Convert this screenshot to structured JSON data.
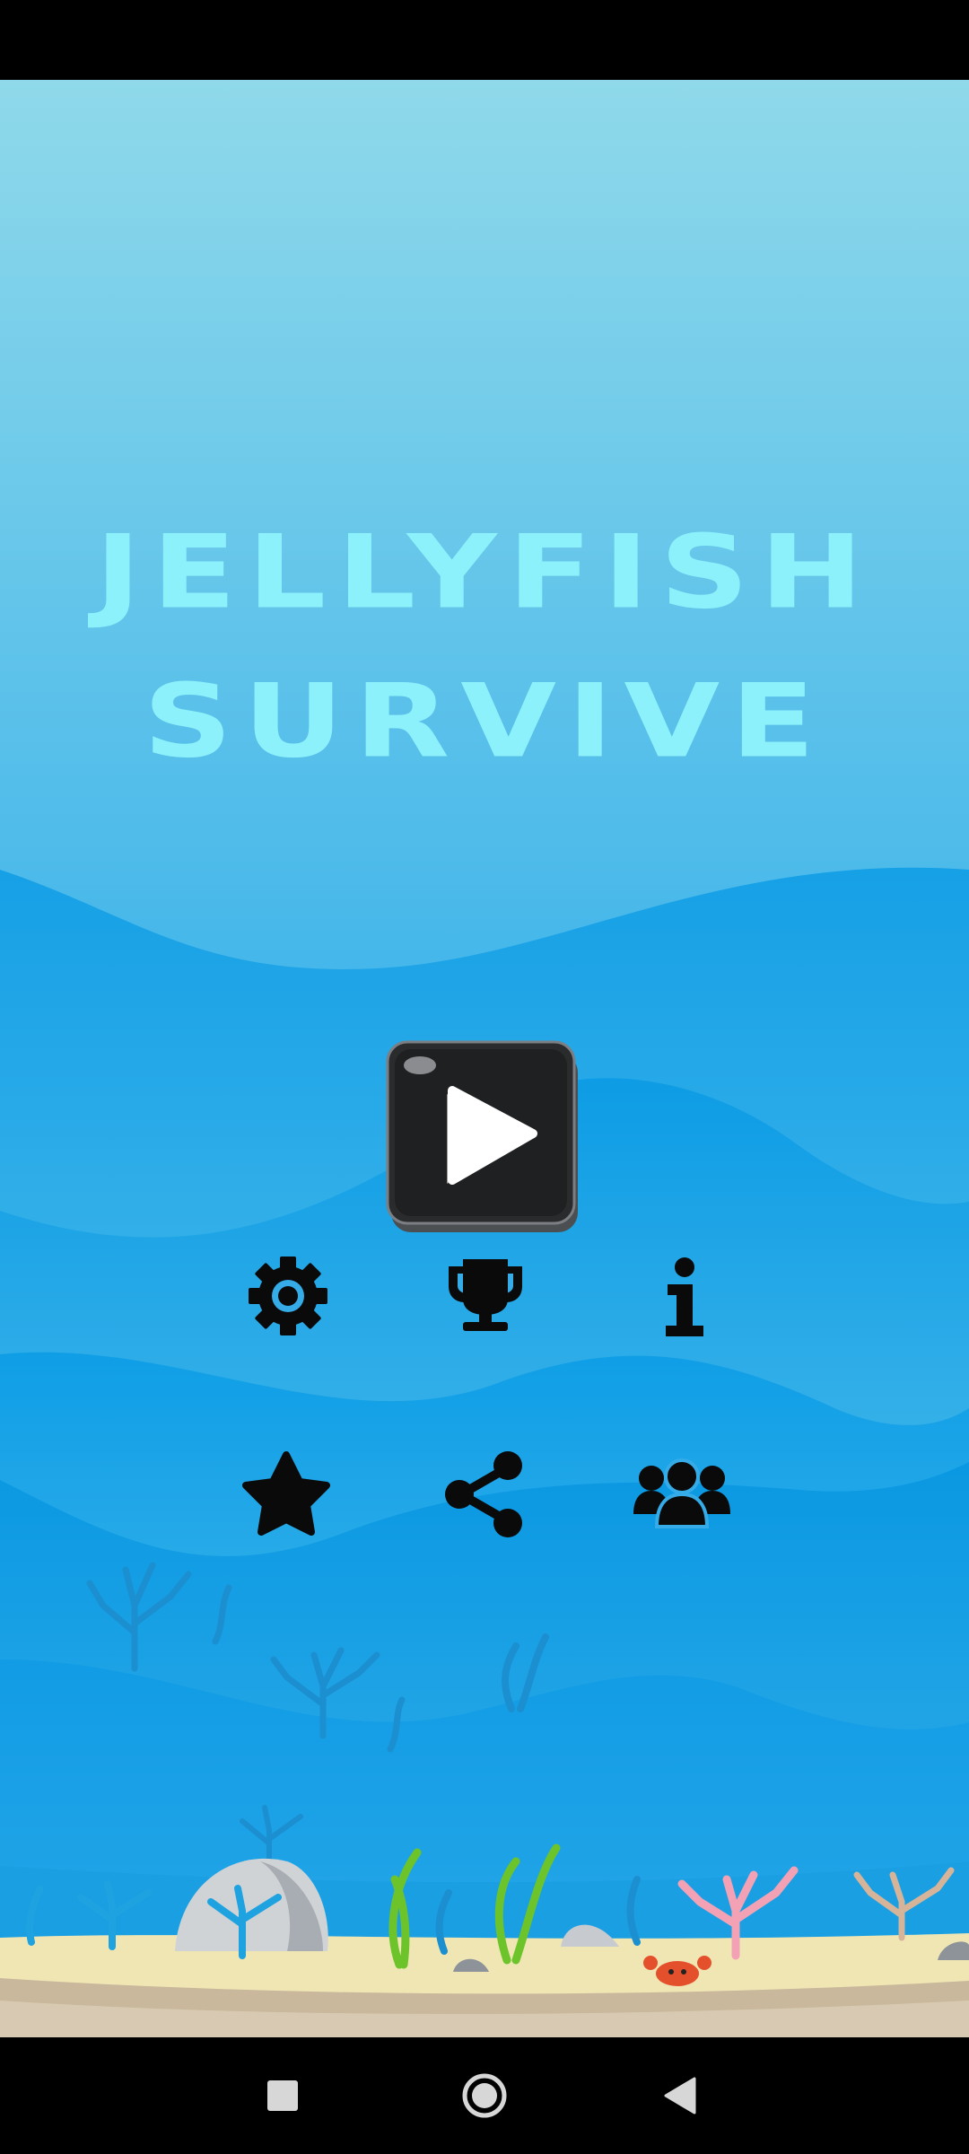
{
  "game": {
    "title_line1": "JELLYFISH",
    "title_line2": "SURVIVE"
  },
  "menu": {
    "play_icon": "play-icon",
    "row1": [
      "settings-gear-icon",
      "trophy-icon",
      "info-icon"
    ],
    "row2": [
      "star-icon",
      "share-icon",
      "group-icon"
    ]
  },
  "navigation": {
    "buttons": [
      "recent-apps-square-icon",
      "home-circle-icon",
      "back-triangle-icon"
    ]
  },
  "colors": {
    "title": "#8df1fb",
    "sky_top": "#8fd9ea",
    "sea_deep": "#0e97e0",
    "sand": "#f0e6b4"
  }
}
